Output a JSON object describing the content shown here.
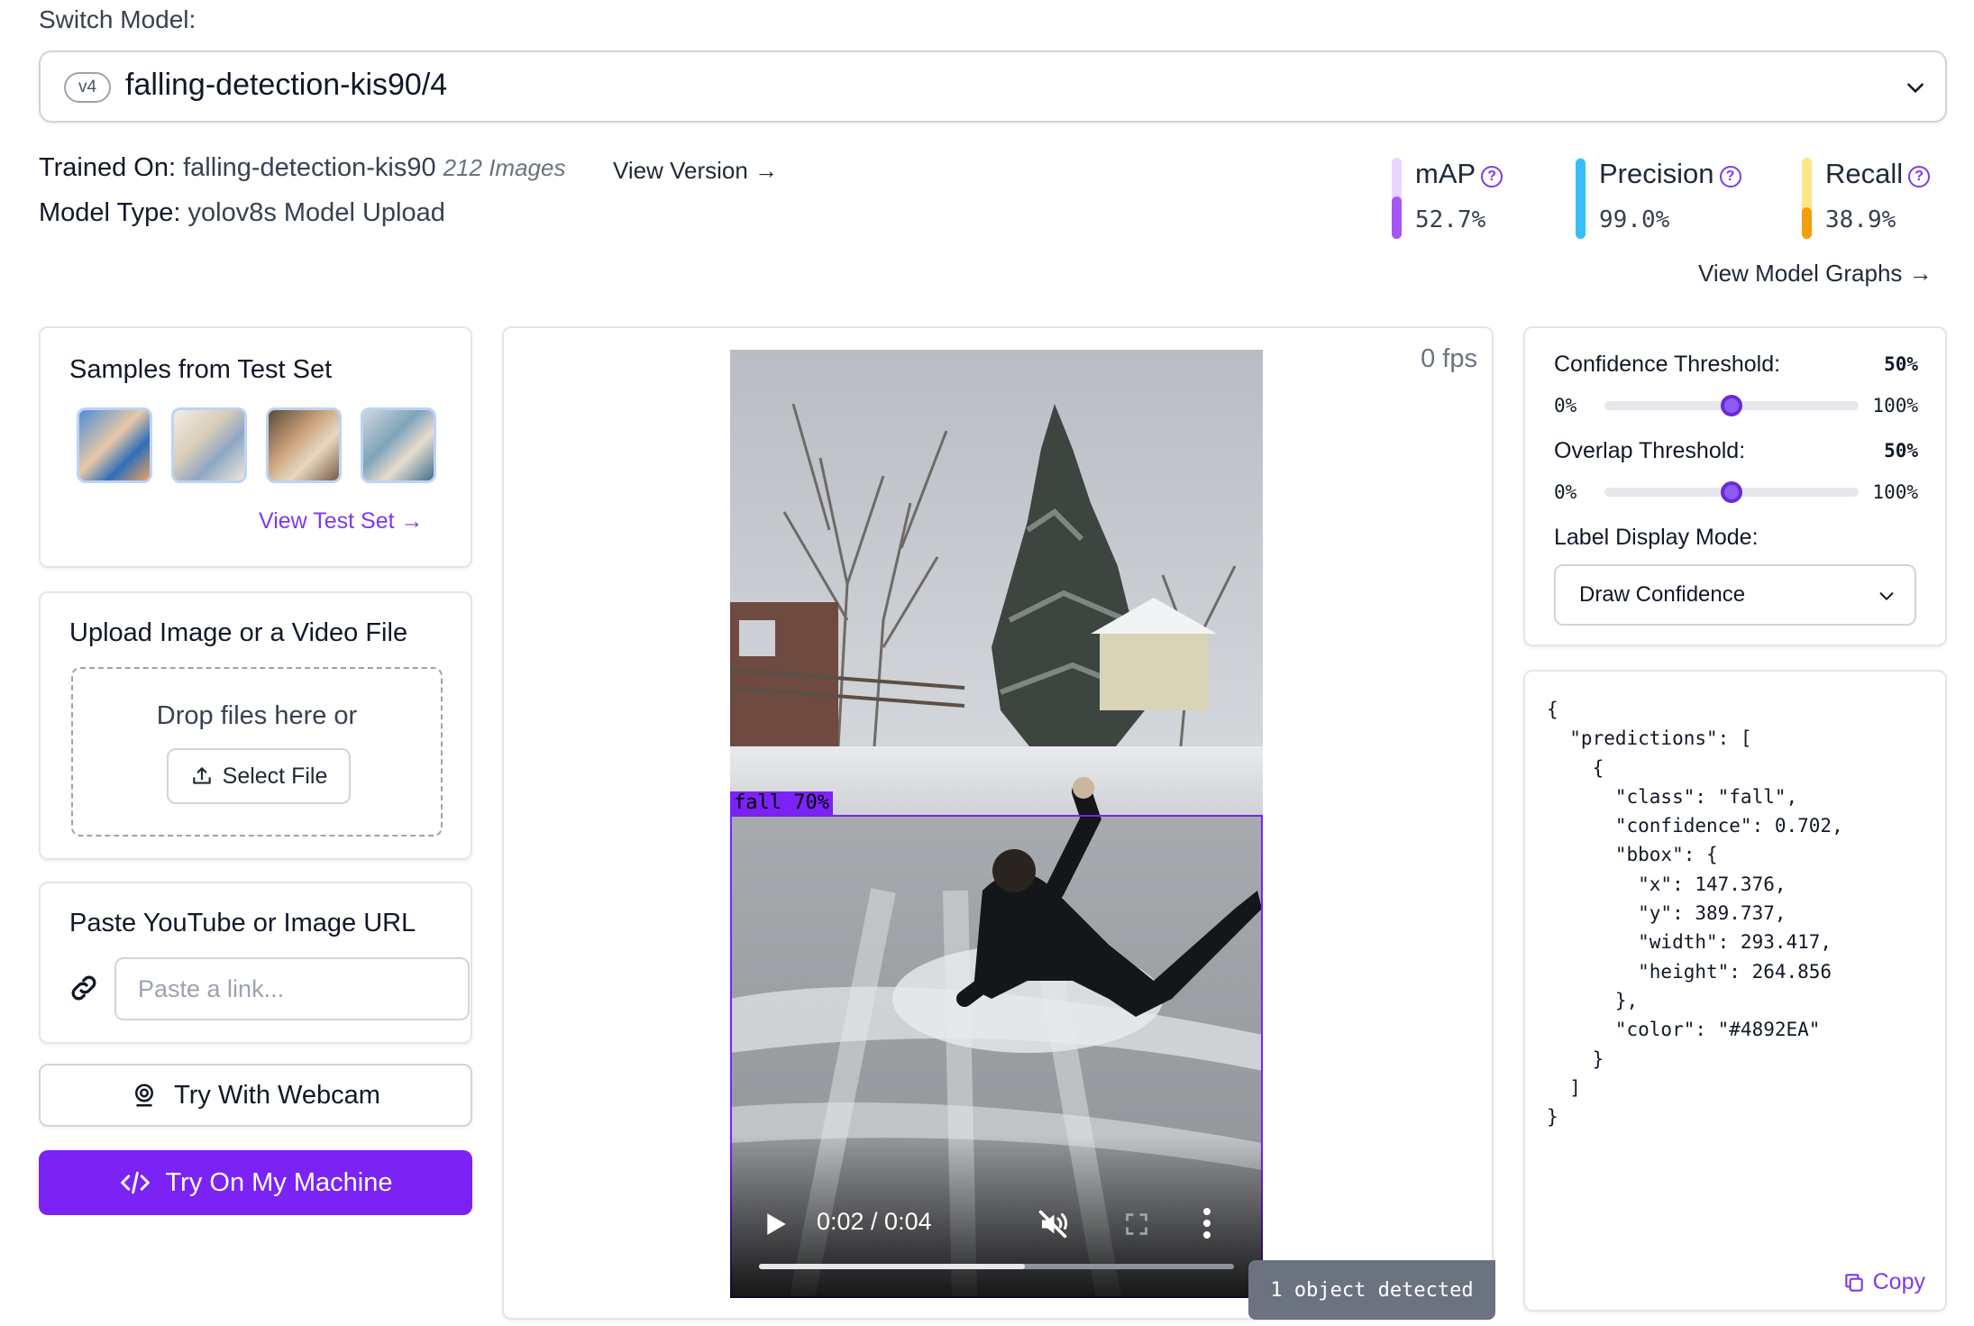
{
  "header": {
    "switch_label": "Switch Model:",
    "version_badge": "v4",
    "model_name": "falling-detection-kis90/4",
    "trained_on_label": "Trained On:",
    "trained_on_value": "falling-detection-kis90",
    "images_count": "212 Images",
    "view_version": "View Version →",
    "model_type_label": "Model Type:",
    "model_type_value": "yolov8s Model Upload",
    "view_graphs": "View Model Graphs →"
  },
  "metrics": [
    {
      "name": "mAP",
      "value": "52.7%",
      "fraction": 0.527,
      "color": "#a855f7",
      "track_color": "#e9d5ff"
    },
    {
      "name": "Precision",
      "value": "99.0%",
      "fraction": 0.99,
      "color": "#38bdf8",
      "track_color": "#bae6fd"
    },
    {
      "name": "Recall",
      "value": "38.9%",
      "fraction": 0.389,
      "color": "#f59e0b",
      "track_color": "#fde68a"
    }
  ],
  "samples": {
    "title": "Samples from Test Set",
    "link": "View Test Set →"
  },
  "upload": {
    "title": "Upload Image or a Video File",
    "drop_text": "Drop files here or",
    "select_label": "Select File"
  },
  "url": {
    "title": "Paste YouTube or Image URL",
    "placeholder": "Paste a link..."
  },
  "buttons": {
    "webcam": "Try With Webcam",
    "machine": "Try On My Machine"
  },
  "video": {
    "fps": "0 fps",
    "bbox_label": "fall 70%",
    "time": "0:02 / 0:04",
    "progress_fraction": 0.56,
    "detected": "1 object detected"
  },
  "settings": {
    "confidence_label": "Confidence Threshold:",
    "confidence_value": "50%",
    "confidence_fraction": 0.5,
    "overlap_label": "Overlap Threshold:",
    "overlap_value": "50%",
    "overlap_fraction": 0.5,
    "slider_min": "0%",
    "slider_max": "100%",
    "display_mode_label": "Label Display Mode:",
    "display_mode_value": "Draw Confidence"
  },
  "output": {
    "json_text": "{\n  \"predictions\": [\n    {\n      \"class\": \"fall\",\n      \"confidence\": 0.702,\n      \"bbox\": {\n        \"x\": 147.376,\n        \"y\": 389.737,\n        \"width\": 293.417,\n        \"height\": 264.856\n      },\n      \"color\": \"#4892EA\"\n    }\n  ]\n}",
    "copy_label": "Copy"
  },
  "colors": {
    "accent": "#7b22f5",
    "bbox": "#7b22f5"
  }
}
